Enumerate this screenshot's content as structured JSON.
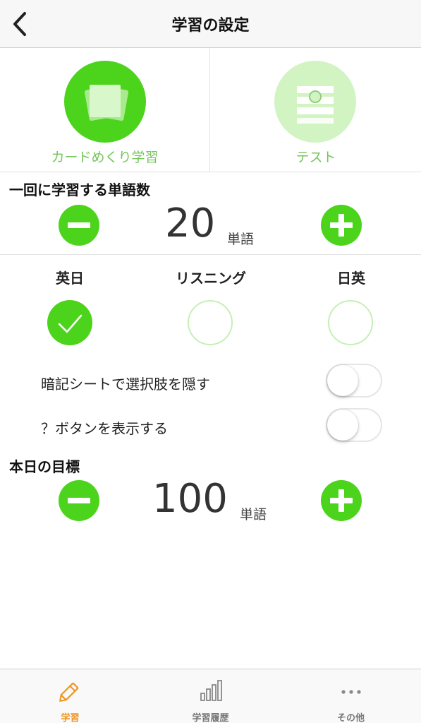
{
  "header": {
    "title": "学習の設定"
  },
  "modes": [
    {
      "label": "カードめくり学習",
      "selected": true
    },
    {
      "label": "テスト",
      "selected": false
    }
  ],
  "word_count": {
    "title": "一回に学習する単語数",
    "value": "20",
    "unit": "単語"
  },
  "directions": [
    {
      "label": "英日",
      "selected": true
    },
    {
      "label": "リスニング",
      "selected": false
    },
    {
      "label": "日英",
      "selected": false
    }
  ],
  "toggles": [
    {
      "label": "暗記シートで選択肢を隠す",
      "on": false
    },
    {
      "label": "？ボタンを表示する",
      "on": false
    }
  ],
  "daily_goal": {
    "title": "本日の目標",
    "value": "100",
    "unit": "単語"
  },
  "tabbar": {
    "items": [
      {
        "label": "学習",
        "icon": "pencil-icon",
        "active": true
      },
      {
        "label": "学習履歴",
        "icon": "bar-chart-icon",
        "active": false
      },
      {
        "label": "その他",
        "icon": "more-dots-icon",
        "active": false
      }
    ]
  },
  "colors": {
    "accent_green": "#4cd41c",
    "light_green": "#d2f4c3",
    "label_green": "#74c65a",
    "tab_active_orange": "#f0941e"
  }
}
